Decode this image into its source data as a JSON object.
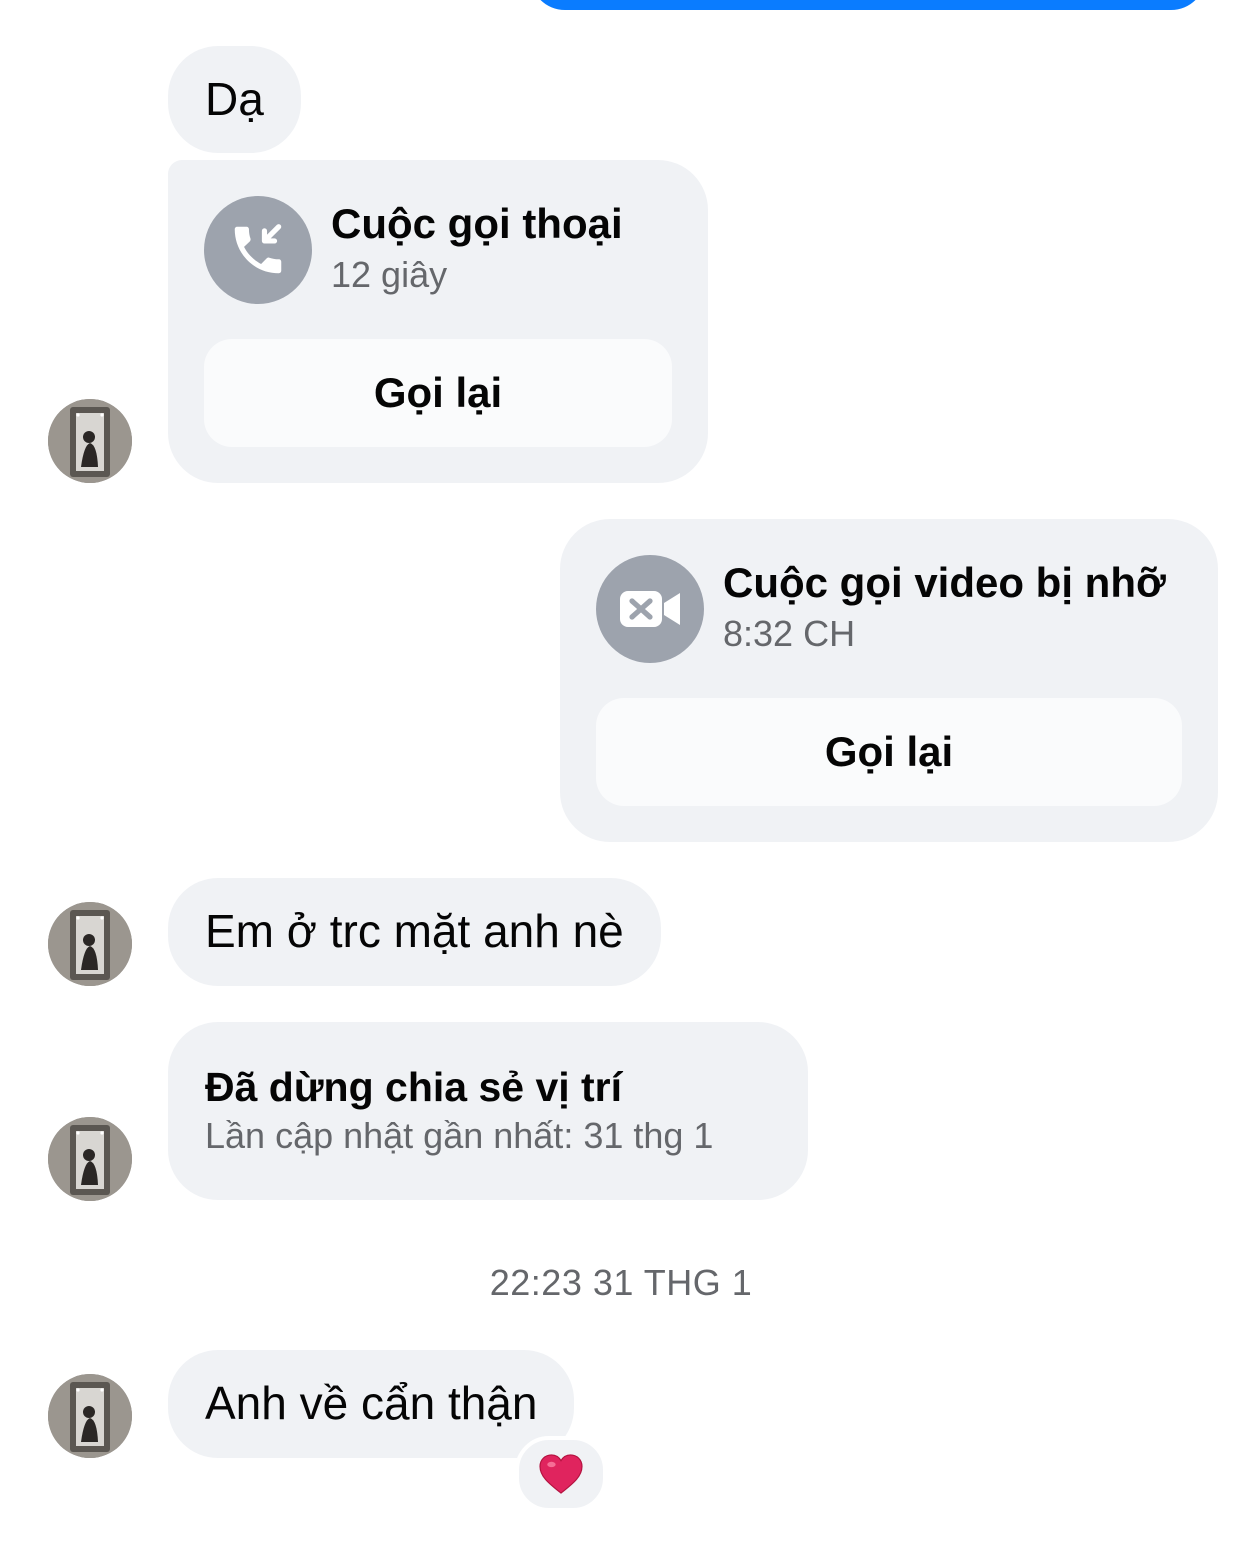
{
  "messages": {
    "m1": {
      "text": "Dạ"
    },
    "voice_call": {
      "title": "Cuộc gọi thoại",
      "subtitle": "12 giây",
      "button_label": "Gọi lại",
      "icon": "incoming-call-icon"
    },
    "video_call": {
      "title": "Cuộc gọi video bị nhỡ",
      "subtitle": "8:32 CH",
      "button_label": "Gọi lại",
      "icon": "missed-video-icon"
    },
    "m2": {
      "text": "Em ở trc mặt anh nè"
    },
    "location": {
      "title": "Đã dừng chia sẻ vị trí",
      "subtitle": "Lần cập nhật gần nhất: 31 thg 1"
    },
    "timestamp": "22:23 31 THG 1",
    "m3": {
      "text": "Anh về cẩn thận",
      "reaction": "❤️"
    }
  },
  "colors": {
    "sent_bubble": "#0a7cff",
    "received_bubble": "#f0f2f5",
    "icon_circle": "#9da3ad",
    "secondary_text": "#65676b",
    "reaction_heart": "#e0245e"
  }
}
